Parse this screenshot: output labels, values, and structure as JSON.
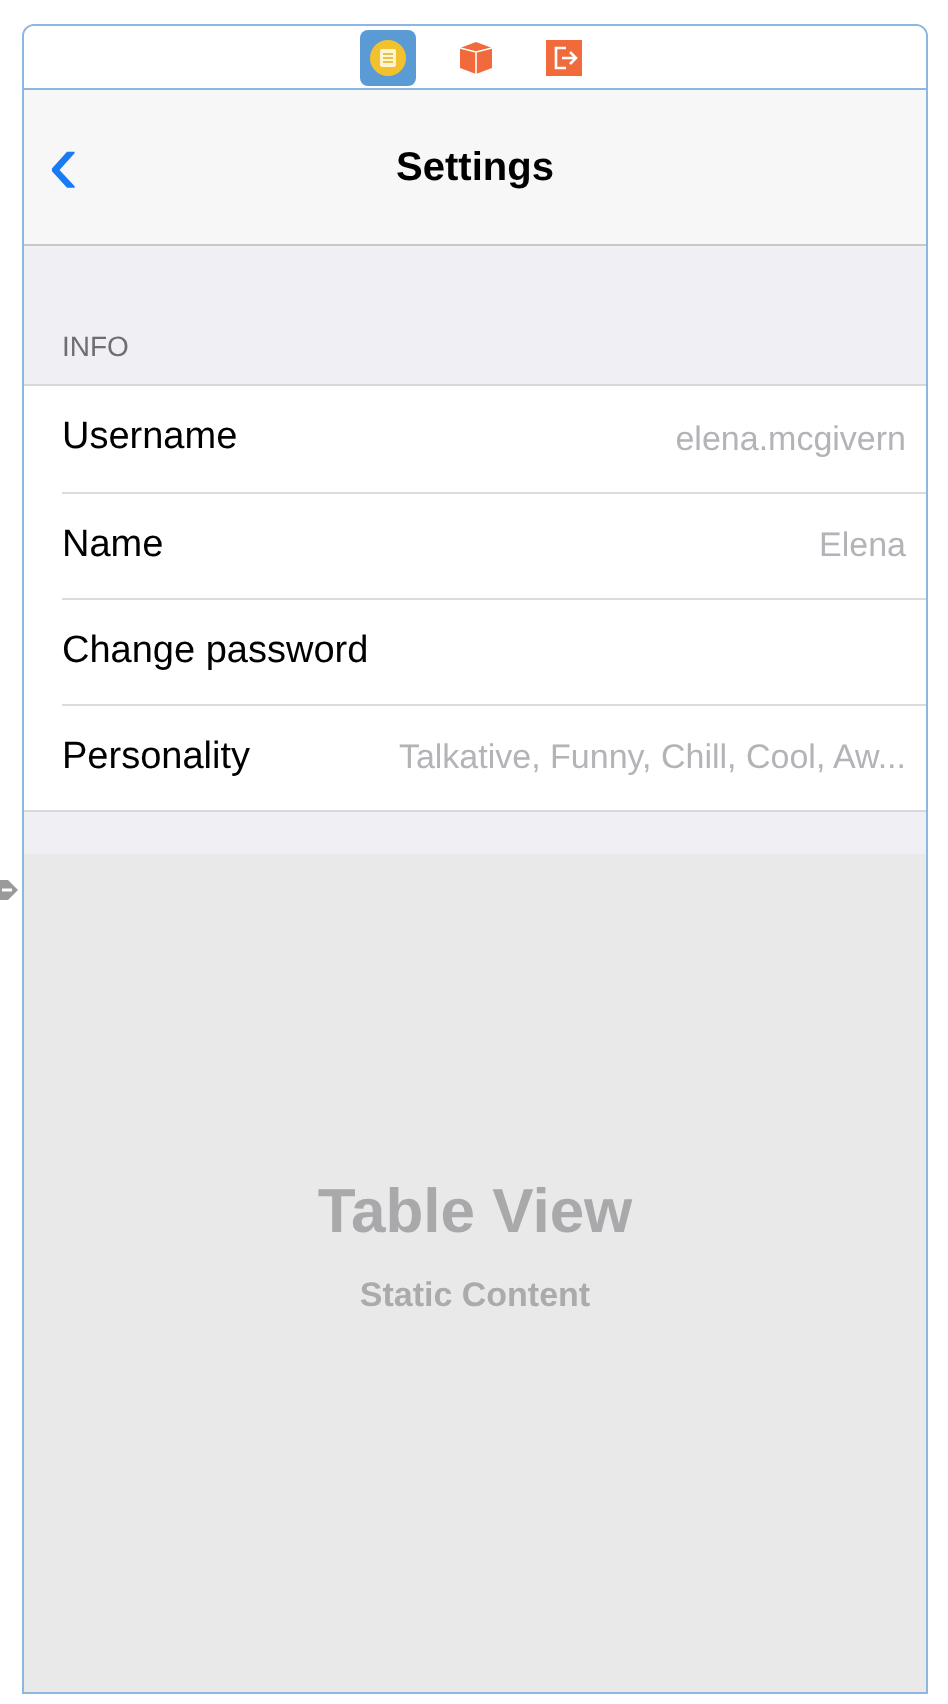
{
  "scene_dock": {
    "icons": [
      {
        "kind": "controller",
        "selected": true
      },
      {
        "kind": "first-responder",
        "selected": false
      },
      {
        "kind": "exit",
        "selected": false
      }
    ]
  },
  "navigation_bar": {
    "back": "‹",
    "title": "Settings"
  },
  "section": {
    "header": "INFO",
    "rows": [
      {
        "label": "Username",
        "value": "elena.mcgivern"
      },
      {
        "label": "Name",
        "value": "Elena"
      },
      {
        "label": "Change password"
      },
      {
        "label": "Personality",
        "value": "Talkative, Funny, Chill, Cool, Aw..."
      }
    ]
  },
  "table_view": {
    "title": "Table View",
    "subtitle": "Static Content"
  }
}
